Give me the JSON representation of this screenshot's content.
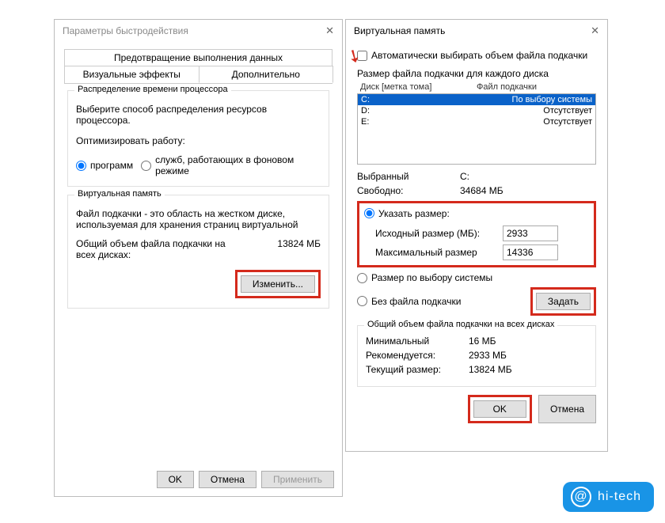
{
  "win1": {
    "title": "Параметры быстродействия",
    "tabs": {
      "top": "Предотвращение выполнения данных",
      "left": "Визуальные эффекты",
      "right": "Дополнительно"
    },
    "group1": {
      "title": "Распределение времени процессора",
      "desc": "Выберите способ распределения ресурсов процессора.",
      "opt_label": "Оптимизировать работу:",
      "opt_programs": "программ",
      "opt_services": "служб, работающих в фоновом режиме"
    },
    "group2": {
      "title": "Виртуальная память",
      "desc": "Файл подкачки - это область на жестком диске, используемая для хранения страниц виртуальной",
      "total_label": "Общий объем файла подкачки на всех дисках:",
      "total_value": "13824 МБ",
      "change_btn": "Изменить..."
    },
    "footer": {
      "ok": "OK",
      "cancel": "Отмена",
      "apply": "Применить"
    }
  },
  "win2": {
    "title": "Виртуальная память",
    "auto_label": "Автоматически выбирать объем файла подкачки",
    "list_title": "Размер файла подкачки для каждого диска",
    "col1": "Диск [метка тома]",
    "col2": "Файл подкачки",
    "rows": [
      {
        "d": "C:",
        "v": "По выбору системы"
      },
      {
        "d": "D:",
        "v": "Отсутствует"
      },
      {
        "d": "E:",
        "v": "Отсутствует"
      }
    ],
    "selected_label": "Выбранный",
    "selected_value": "C:",
    "free_label": "Свободно:",
    "free_value": "34684 МБ",
    "custom_label": "Указать размер:",
    "initial_label": "Исходный размер (МБ):",
    "initial_value": "2933",
    "max_label": "Максимальный размер",
    "max_value": "14336",
    "system_label": "Размер по выбору системы",
    "none_label": "Без файла подкачки",
    "set_btn": "Задать",
    "totals_title": "Общий объем файла подкачки на всех дисках",
    "min_label": "Минимальный",
    "min_value": "16 МБ",
    "rec_label": "Рекомендуется:",
    "rec_value": "2933 МБ",
    "cur_label": "Текущий размер:",
    "cur_value": "13824 МБ",
    "ok": "OK",
    "cancel": "Отмена"
  },
  "watermark": "hi-tech"
}
